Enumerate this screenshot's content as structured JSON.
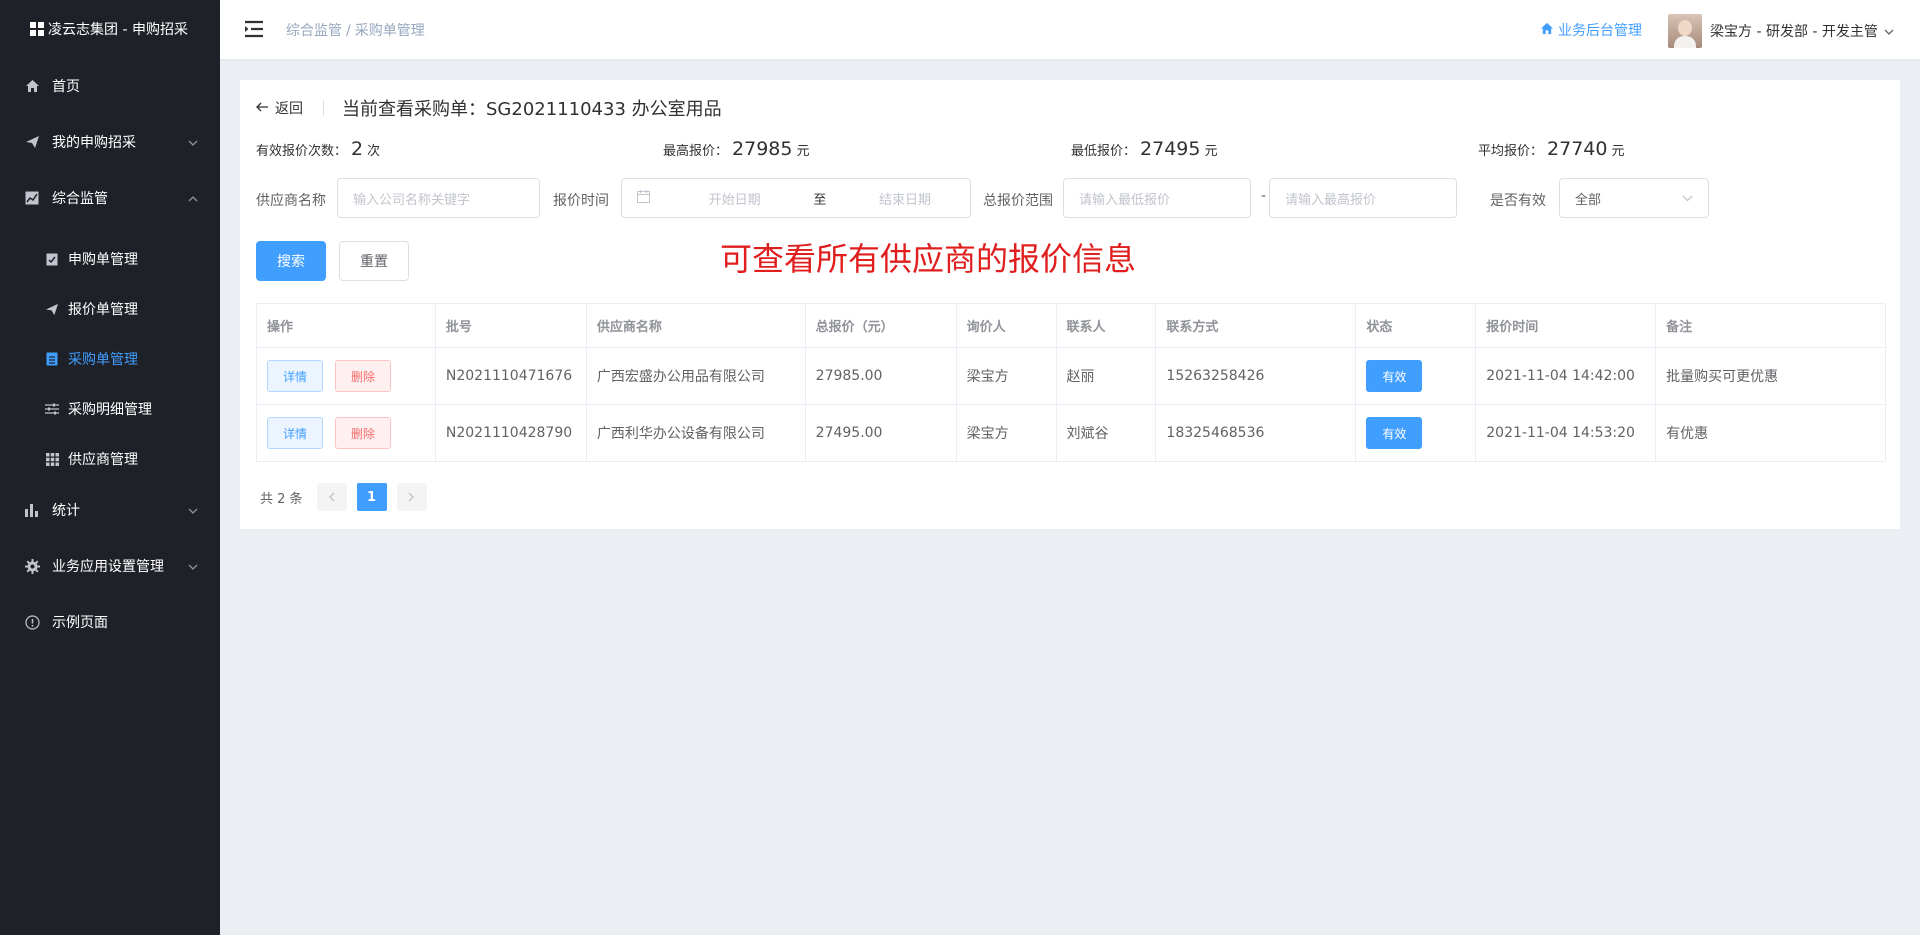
{
  "app": {
    "title": "凌云志集团 - 申购招采"
  },
  "sidebar": {
    "items": [
      {
        "label": "首页"
      },
      {
        "label": "我的申购招采"
      },
      {
        "label": "综合监管"
      },
      {
        "label": "统计"
      },
      {
        "label": "业务应用设置管理"
      },
      {
        "label": "示例页面"
      }
    ],
    "sub_items": [
      {
        "label": "申购单管理"
      },
      {
        "label": "报价单管理"
      },
      {
        "label": "采购单管理"
      },
      {
        "label": "采购明细管理"
      },
      {
        "label": "供应商管理"
      }
    ]
  },
  "header": {
    "breadcrumb": [
      "综合监管",
      "采购单管理"
    ],
    "biz_link": "业务后台管理",
    "user": "梁宝方 - 研发部 - 开发主管"
  },
  "page": {
    "back": "返回",
    "title": "当前查看采购单：SG2021110433 办公室用品"
  },
  "stats": {
    "valid_count_label": "有效报价次数：",
    "valid_count": "2",
    "valid_count_unit": "次",
    "max_label": "最高报价：",
    "max": "27985",
    "min_label": "最低报价：",
    "min": "27495",
    "avg_label": "平均报价：",
    "avg": "27740",
    "price_unit": "元"
  },
  "filters": {
    "supplier_label": "供应商名称",
    "supplier_placeholder": "输入公司名称关键字",
    "time_label": "报价时间",
    "start_placeholder": "开始日期",
    "to": "至",
    "end_placeholder": "结束日期",
    "range_label": "总报价范围",
    "min_placeholder": "请输入最低报价",
    "dash": "-",
    "max_placeholder": "请输入最高报价",
    "valid_label": "是否有效",
    "valid_value": "全部"
  },
  "buttons": {
    "search": "搜索",
    "reset": "重置"
  },
  "annotation": "可查看所有供应商的报价信息",
  "table": {
    "columns": [
      "操作",
      "批号",
      "供应商名称",
      "总报价（元）",
      "询价人",
      "联系人",
      "联系方式",
      "状态",
      "报价时间",
      "备注"
    ],
    "detail_label": "详情",
    "delete_label": "删除",
    "rows": [
      {
        "batch": "N2021110471676",
        "supplier": "广西宏盛办公用品有限公司",
        "total": "27985.00",
        "inquirer": "梁宝方",
        "contact": "赵丽",
        "phone": "15263258426",
        "status": "有效",
        "time": "2021-11-04 14:42:00",
        "note": "批量购买可更优惠"
      },
      {
        "batch": "N2021110428790",
        "supplier": "广西利华办公设备有限公司",
        "total": "27495.00",
        "inquirer": "梁宝方",
        "contact": "刘斌谷",
        "phone": "18325468536",
        "status": "有效",
        "time": "2021-11-04 14:53:20",
        "note": "有优惠"
      }
    ]
  },
  "pagination": {
    "total": "共 2 条",
    "current": "1"
  },
  "colors": {
    "primary": "#409eff",
    "sidebar": "#1f2129",
    "annotation": "#e01e1e"
  }
}
